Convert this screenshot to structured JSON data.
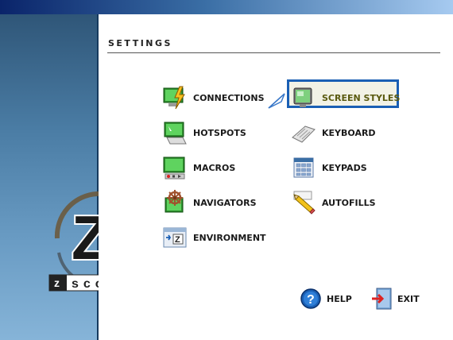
{
  "page": {
    "heading": "SETTINGS"
  },
  "menu": {
    "connections": "CONNECTIONS",
    "hotspots": "HOTSPOTS",
    "macros": "MACROS",
    "navigators": "NAVIGATORS",
    "environment": "ENVIRONMENT",
    "screen_styles": "SCREEN STYLES",
    "keyboard": "KEYBOARD",
    "keypads": "KEYPADS",
    "autofills": "AUTOFILLS"
  },
  "footer": {
    "help": "HELP",
    "exit": "EXIT"
  },
  "logo": {
    "brand": "zscope",
    "letter": "Z"
  },
  "colors": {
    "accent": "#1a5fb4",
    "sidebar": "#4a7ca4",
    "title_start": "#0a246a",
    "title_end": "#a6caf0"
  },
  "icons": {
    "connections": "lightning-monitor-icon",
    "hotspots": "hotspot-monitor-icon",
    "macros": "macro-monitor-icon",
    "navigators": "helm-wheel-icon",
    "environment": "environment-icon",
    "screen_styles": "screen-icon",
    "keyboard": "keyboard-icon",
    "keypads": "keypad-icon",
    "autofills": "pencil-icon",
    "help": "help-icon",
    "exit": "exit-door-icon"
  },
  "state": {
    "selected": "screen_styles"
  }
}
